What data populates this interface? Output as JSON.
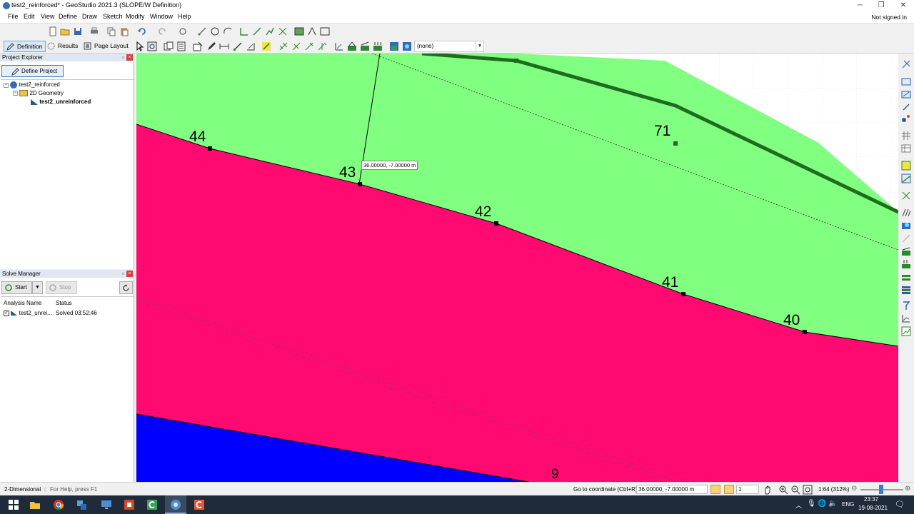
{
  "window": {
    "title": "test2_reinforced* - GeoStudio 2021.3 (SLOPE/W Definition)",
    "controls": [
      "─",
      "❐",
      "✕"
    ]
  },
  "menu": {
    "items": [
      "File",
      "Edit",
      "View",
      "Define",
      "Draw",
      "Sketch",
      "Modify",
      "Window",
      "Help"
    ],
    "account": "Not signed in"
  },
  "tabs": {
    "definition": "Definition",
    "results": "Results",
    "page_layout": "Page Layout"
  },
  "toolbar": {
    "dropdown_value": "(none)"
  },
  "project_explorer": {
    "title": "Project Explorer",
    "define_button": "Define Project",
    "tree": {
      "root": "test2_reinforced",
      "folder": "2D Geometry",
      "item": "test2_unreinforced"
    }
  },
  "solve_manager": {
    "title": "Solve Manager",
    "start": "Start",
    "stop": "Stop",
    "columns": [
      "Analysis Name",
      "Status"
    ],
    "rows": [
      {
        "name": "test2_unrei...",
        "status": "Solved 03:52:46"
      }
    ]
  },
  "canvas": {
    "tooltip": "36.00000, -7.00000 m",
    "point_labels": [
      "44",
      "43",
      "42",
      "71",
      "41",
      "40",
      "9"
    ],
    "colors": {
      "upper_region": "#80ff80",
      "middle_region": "#ff0a70",
      "lower_region": "#0000ff",
      "slope_line": "#1f6b1f",
      "background": "#ffffff"
    }
  },
  "statusbar": {
    "mode": "2-Dimensional",
    "help": "For Help, press F1",
    "goto_label": "Go to coordinate (Ctrl+R):",
    "goto_value": "36.00000, -7.00000 m",
    "spin_value": "1",
    "scale": "1:64 (312%)"
  },
  "taskbar": {
    "lang": "ENG",
    "time": "23:37",
    "date": "19-08-2021"
  }
}
